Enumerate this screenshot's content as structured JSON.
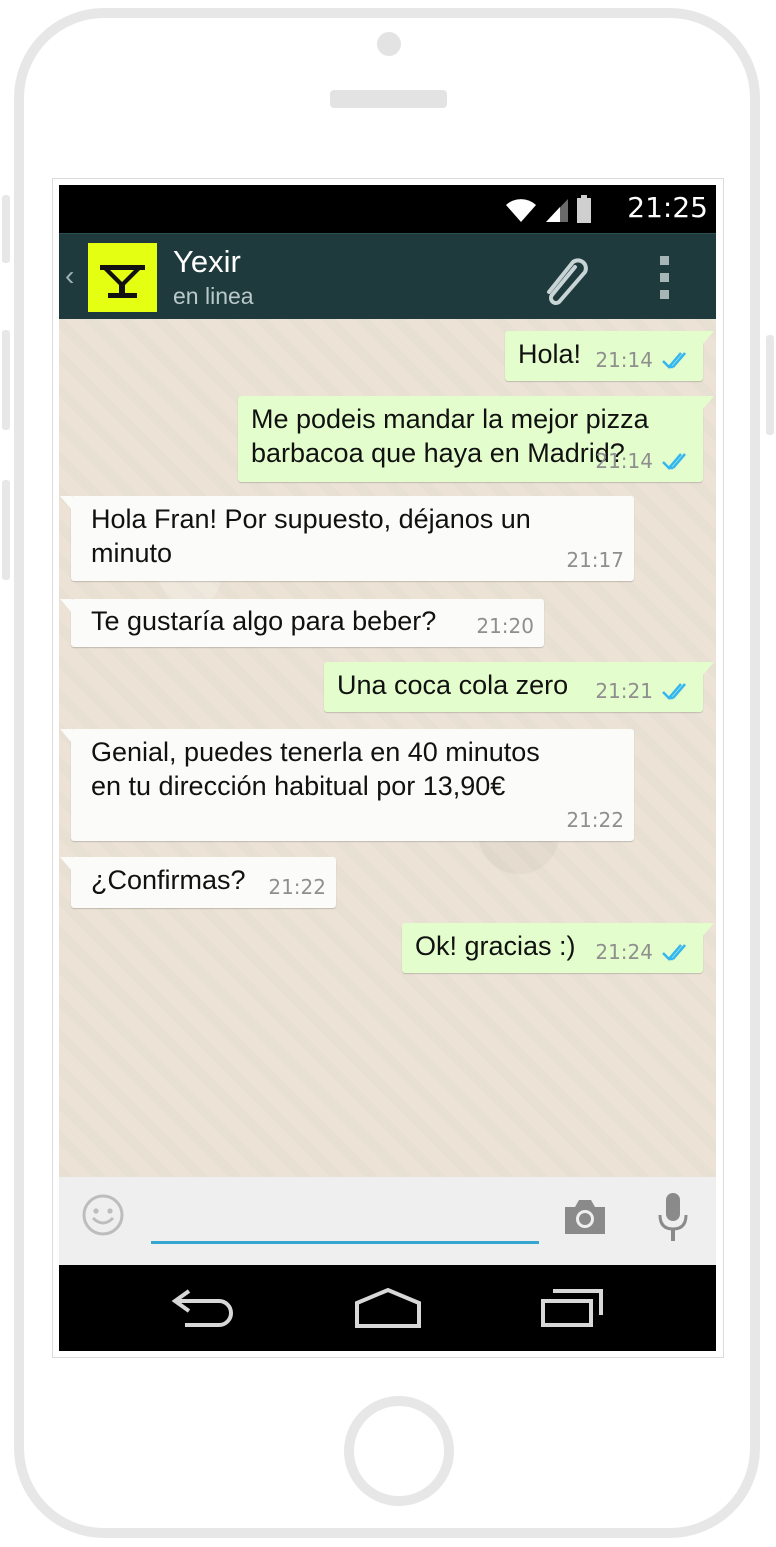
{
  "status_bar": {
    "time": "21:25"
  },
  "header": {
    "back_glyph": "‹",
    "contact_name": "Yexir",
    "contact_status": "en linea",
    "avatar_color": "#e5ff13",
    "avatar_logo": "yexir-logo",
    "attach_icon": "paperclip-icon",
    "menu_icon": "overflow-menu-icon"
  },
  "messages": [
    {
      "direction": "out",
      "lines": [
        "Hola!"
      ],
      "time": "21:14",
      "read": true
    },
    {
      "direction": "out",
      "lines": [
        "Me podeis mandar la mejor pizza",
        "barbacoa que haya en Madrid?"
      ],
      "time": "21:14",
      "read": true
    },
    {
      "direction": "in",
      "lines": [
        "Hola Fran! Por supuesto, déjanos un",
        "minuto"
      ],
      "time": "21:17"
    },
    {
      "direction": "in",
      "lines": [
        "Te gustaría algo para beber?"
      ],
      "time": "21:20"
    },
    {
      "direction": "out",
      "lines": [
        "Una coca cola zero"
      ],
      "time": "21:21",
      "read": true
    },
    {
      "direction": "in",
      "lines": [
        "Genial, puedes tenerla en 40 minutos",
        "en tu dirección habitual por 13,90€"
      ],
      "time": "21:22"
    },
    {
      "direction": "in",
      "lines": [
        "¿Confirmas?"
      ],
      "time": "21:22"
    },
    {
      "direction": "out",
      "lines": [
        "Ok! gracias :)"
      ],
      "time": "21:24",
      "read": true
    }
  ],
  "input_bar": {
    "value": "",
    "emoji_icon": "smiley-icon",
    "camera_icon": "camera-icon",
    "mic_icon": "microphone-icon"
  },
  "nav_bar": {
    "back_icon": "back-arrow-icon",
    "home_icon": "home-icon",
    "recents_icon": "recent-apps-icon"
  },
  "colors": {
    "header_bg": "#1f3a3d",
    "outgoing_bubble": "#e3fdcc",
    "incoming_bubble": "#fbfbf9",
    "read_ticks": "#34b7f1",
    "input_underline": "#34a6cf"
  }
}
